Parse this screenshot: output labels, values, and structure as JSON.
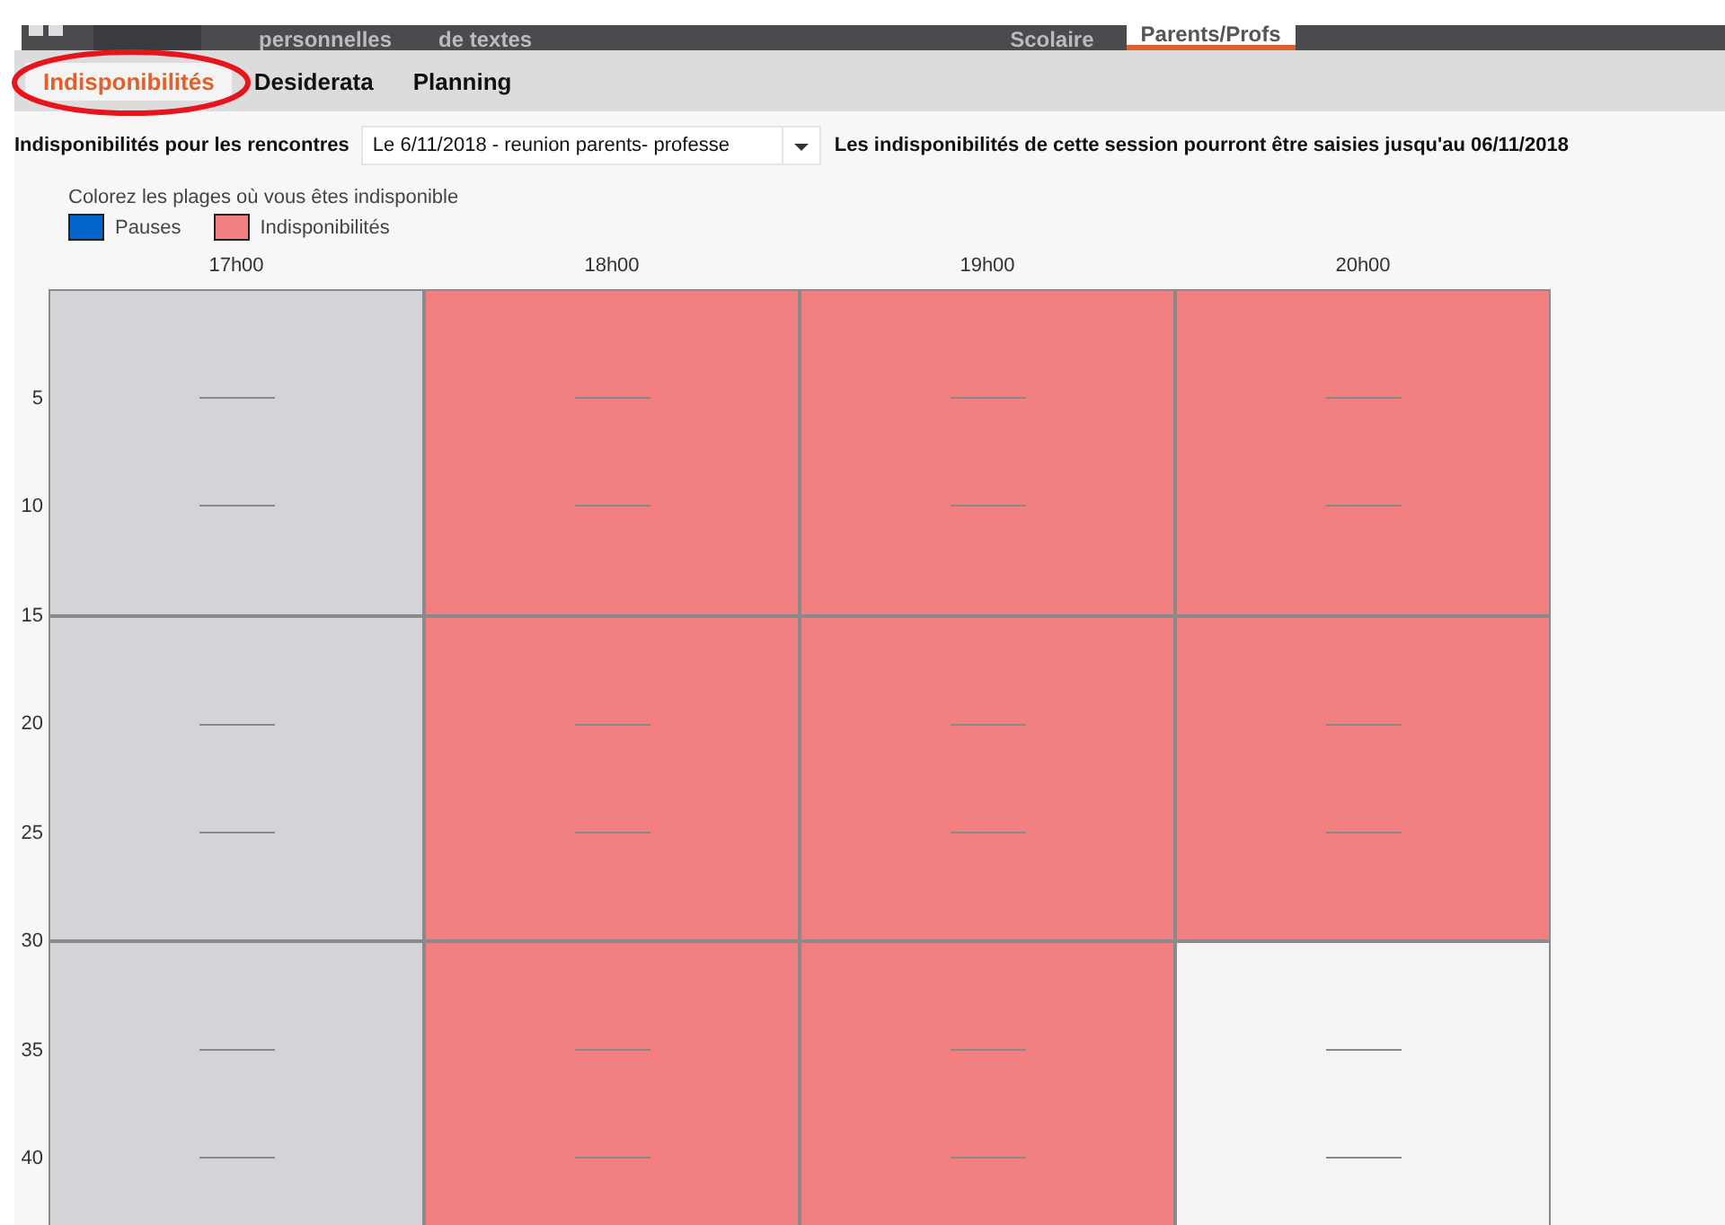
{
  "top_nav": {
    "items": [
      {
        "label": "personnelles",
        "selected": false
      },
      {
        "label": "de textes",
        "selected": false
      },
      {
        "label": "Scolaire",
        "selected": false
      },
      {
        "label": "Parents/Profs",
        "selected": true
      }
    ]
  },
  "tabs": [
    {
      "label": "Indisponibilités",
      "selected": true,
      "circled": true
    },
    {
      "label": "Desiderata",
      "selected": false,
      "circled": false
    },
    {
      "label": "Planning",
      "selected": false,
      "circled": false
    }
  ],
  "session": {
    "label": "Indisponibilités pour les rencontres",
    "value": "Le 6/11/2018 - reunion parents- professe",
    "note": "Les indisponibilités de cette session pourront être saisies jusqu'au 06/11/2018"
  },
  "legend": {
    "hint": "Colorez les plages où vous êtes indisponible",
    "items": [
      {
        "label": "Pauses",
        "color": "#0066cc"
      },
      {
        "label": "Indisponibilités",
        "color": "#f28080"
      }
    ]
  },
  "grid": {
    "columns": [
      "17h00",
      "18h00",
      "19h00",
      "20h00"
    ],
    "time_labels": [
      "5",
      "10",
      "15",
      "20",
      "25",
      "30",
      "35",
      "40"
    ],
    "rows": [
      {
        "cells": [
          {
            "disabled": true,
            "unavailable": false
          },
          {
            "disabled": false,
            "unavailable": true
          },
          {
            "disabled": false,
            "unavailable": true
          },
          {
            "disabled": false,
            "unavailable": true
          }
        ]
      },
      {
        "cells": [
          {
            "disabled": true,
            "unavailable": false
          },
          {
            "disabled": false,
            "unavailable": true
          },
          {
            "disabled": false,
            "unavailable": true
          },
          {
            "disabled": false,
            "unavailable": true
          }
        ]
      },
      {
        "cells": [
          {
            "disabled": true,
            "unavailable": false
          },
          {
            "disabled": false,
            "unavailable": true
          },
          {
            "disabled": false,
            "unavailable": true
          },
          {
            "disabled": false,
            "unavailable": false
          }
        ]
      }
    ]
  }
}
